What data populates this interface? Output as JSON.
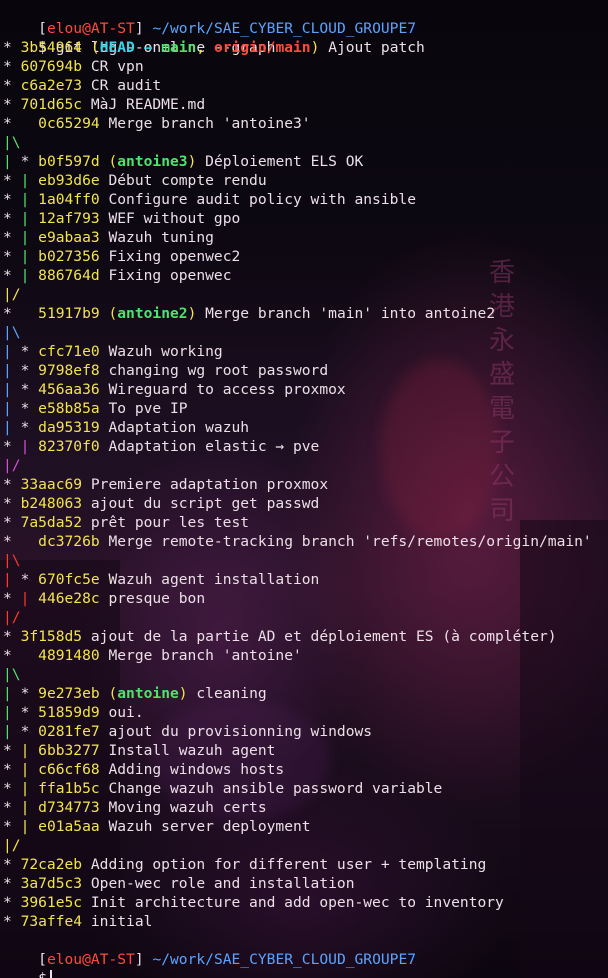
{
  "prompt": {
    "open_bracket": "[",
    "user": "elou",
    "at": "@",
    "host": "AT-ST",
    "close_bracket": "]",
    "path": "~/work/SAE_CYBER_CLOUD_GROUPE7",
    "dollar": "$"
  },
  "command": "git log --oneline --graph",
  "colors": {
    "hash": "#f2e44f",
    "head_ref": "#36d6e7",
    "local_branch": "#4fe36b",
    "remote_branch": "#ff4a3a",
    "path": "#5aa3ff",
    "prompt_user": "#ff4a3a",
    "graph_green": "#4fe36b",
    "graph_blue": "#5aa3ff",
    "graph_magenta": "#d64fd6",
    "graph_red": "#ff3a2a",
    "graph_yellow": "#f2e44f"
  },
  "log": [
    {
      "graph": [
        [
          "* ",
          ""
        ]
      ],
      "hash": "3b54964",
      "refs": "head_main",
      "msg": "Ajout patch"
    },
    {
      "graph": [
        [
          "* ",
          ""
        ]
      ],
      "hash": "607694b",
      "msg": "CR vpn"
    },
    {
      "graph": [
        [
          "* ",
          ""
        ]
      ],
      "hash": "c6a2e73",
      "msg": "CR audit"
    },
    {
      "graph": [
        [
          "* ",
          ""
        ]
      ],
      "hash": "701d65c",
      "msg": "MàJ README.md"
    },
    {
      "graph": [
        [
          "*   ",
          ""
        ]
      ],
      "hash": "0c65294",
      "msg": "Merge branch 'antoine3'"
    },
    {
      "graph": [
        [
          "|\\",
          "green"
        ]
      ]
    },
    {
      "graph": [
        [
          "| ",
          "green"
        ],
        [
          "* ",
          ""
        ]
      ],
      "hash": "b0f597d",
      "refs": "antoine3",
      "msg": "Déploiement ELS OK"
    },
    {
      "graph": [
        [
          "* ",
          ""
        ],
        [
          "| ",
          "green"
        ]
      ],
      "hash": "eb93d6e",
      "msg": "Début compte rendu"
    },
    {
      "graph": [
        [
          "* ",
          ""
        ],
        [
          "| ",
          "green"
        ]
      ],
      "hash": "1a04ff0",
      "msg": "Configure audit policy with ansible"
    },
    {
      "graph": [
        [
          "* ",
          ""
        ],
        [
          "| ",
          "green"
        ]
      ],
      "hash": "12af793",
      "msg": "WEF without gpo"
    },
    {
      "graph": [
        [
          "* ",
          ""
        ],
        [
          "| ",
          "green"
        ]
      ],
      "hash": "e9abaa3",
      "msg": "Wazuh tuning"
    },
    {
      "graph": [
        [
          "* ",
          ""
        ],
        [
          "| ",
          "green"
        ]
      ],
      "hash": "b027356",
      "msg": "Fixing openwec2"
    },
    {
      "graph": [
        [
          "* ",
          ""
        ],
        [
          "| ",
          "green"
        ]
      ],
      "hash": "886764d",
      "msg": "Fixing openwec"
    },
    {
      "graph": [
        [
          "|/",
          "yellow"
        ]
      ]
    },
    {
      "graph": [
        [
          "*   ",
          ""
        ]
      ],
      "hash": "51917b9",
      "refs": "antoine2",
      "msg": "Merge branch 'main' into antoine2"
    },
    {
      "graph": [
        [
          "|\\",
          "blue"
        ]
      ]
    },
    {
      "graph": [
        [
          "| ",
          "blue"
        ],
        [
          "* ",
          ""
        ]
      ],
      "hash": "cfc71e0",
      "msg": "Wazuh working"
    },
    {
      "graph": [
        [
          "| ",
          "blue"
        ],
        [
          "* ",
          ""
        ]
      ],
      "hash": "9798ef8",
      "msg": "changing wg root password"
    },
    {
      "graph": [
        [
          "| ",
          "blue"
        ],
        [
          "* ",
          ""
        ]
      ],
      "hash": "456aa36",
      "msg": "Wireguard to access proxmox"
    },
    {
      "graph": [
        [
          "| ",
          "blue"
        ],
        [
          "* ",
          ""
        ]
      ],
      "hash": "e58b85a",
      "msg": "To pve IP"
    },
    {
      "graph": [
        [
          "| ",
          "blue"
        ],
        [
          "* ",
          ""
        ]
      ],
      "hash": "da95319",
      "msg": "Adaptation wazuh"
    },
    {
      "graph": [
        [
          "* ",
          ""
        ],
        [
          "| ",
          "magenta"
        ]
      ],
      "hash": "82370f0",
      "msg": "Adaptation elastic → pve"
    },
    {
      "graph": [
        [
          "|/",
          "magenta"
        ]
      ]
    },
    {
      "graph": [
        [
          "* ",
          ""
        ]
      ],
      "hash": "33aac69",
      "msg": "Premiere adaptation proxmox"
    },
    {
      "graph": [
        [
          "* ",
          ""
        ]
      ],
      "hash": "b248063",
      "msg": "ajout du script get passwd"
    },
    {
      "graph": [
        [
          "* ",
          ""
        ]
      ],
      "hash": "7a5da52",
      "msg": "prêt pour les test"
    },
    {
      "graph": [
        [
          "*   ",
          ""
        ]
      ],
      "hash": "dc3726b",
      "msg": "Merge remote-tracking branch 'refs/remotes/origin/main'"
    },
    {
      "graph": [
        [
          "|\\",
          "red"
        ]
      ]
    },
    {
      "graph": [
        [
          "| ",
          "red"
        ],
        [
          "* ",
          ""
        ]
      ],
      "hash": "670fc5e",
      "msg": "Wazuh agent installation"
    },
    {
      "graph": [
        [
          "* ",
          ""
        ],
        [
          "| ",
          "red"
        ]
      ],
      "hash": "446e28c",
      "msg": "presque bon"
    },
    {
      "graph": [
        [
          "|/",
          "red"
        ]
      ]
    },
    {
      "graph": [
        [
          "* ",
          ""
        ]
      ],
      "hash": "3f158d5",
      "msg": "ajout de la partie AD et déploiement ES (à compléter)"
    },
    {
      "graph": [
        [
          "*   ",
          ""
        ]
      ],
      "hash": "4891480",
      "msg": "Merge branch 'antoine'"
    },
    {
      "graph": [
        [
          "|\\",
          "green"
        ]
      ]
    },
    {
      "graph": [
        [
          "| ",
          "green"
        ],
        [
          "* ",
          ""
        ]
      ],
      "hash": "9e273eb",
      "refs": "antoine",
      "msg": "cleaning"
    },
    {
      "graph": [
        [
          "| ",
          "green"
        ],
        [
          "* ",
          ""
        ]
      ],
      "hash": "51859d9",
      "msg": "oui."
    },
    {
      "graph": [
        [
          "| ",
          "green"
        ],
        [
          "* ",
          ""
        ]
      ],
      "hash": "0281fe7",
      "msg": "ajout du provisionning windows"
    },
    {
      "graph": [
        [
          "* ",
          ""
        ],
        [
          "| ",
          "yellow"
        ]
      ],
      "hash": "6bb3277",
      "msg": "Install wazuh agent"
    },
    {
      "graph": [
        [
          "* ",
          ""
        ],
        [
          "| ",
          "yellow"
        ]
      ],
      "hash": "c66cf68",
      "msg": "Adding windows hosts"
    },
    {
      "graph": [
        [
          "* ",
          ""
        ],
        [
          "| ",
          "yellow"
        ]
      ],
      "hash": "ffa1b5c",
      "msg": "Change wazuh ansible password variable"
    },
    {
      "graph": [
        [
          "* ",
          ""
        ],
        [
          "| ",
          "yellow"
        ]
      ],
      "hash": "d734773",
      "msg": "Moving wazuh certs"
    },
    {
      "graph": [
        [
          "* ",
          ""
        ],
        [
          "| ",
          "yellow"
        ]
      ],
      "hash": "e01a5aa",
      "msg": "Wazuh server deployment"
    },
    {
      "graph": [
        [
          "|/",
          "yellow"
        ]
      ]
    },
    {
      "graph": [
        [
          "* ",
          ""
        ]
      ],
      "hash": "72ca2eb",
      "msg": "Adding option for different user + templating"
    },
    {
      "graph": [
        [
          "* ",
          ""
        ]
      ],
      "hash": "3a7d5c3",
      "msg": "Open-wec role and installation"
    },
    {
      "graph": [
        [
          "* ",
          ""
        ]
      ],
      "hash": "3961e5c",
      "msg": "Init architecture and add open-wec to inventory"
    },
    {
      "graph": [
        [
          "* ",
          ""
        ]
      ],
      "hash": "73affe4",
      "msg": "initial"
    }
  ],
  "ref_labels": {
    "open": "(",
    "close": ")",
    "head": "HEAD",
    "arrow": " → ",
    "main": "main",
    "comma": ", ",
    "origin_main": "origin/main",
    "antoine3": "antoine3",
    "antoine2": "antoine2",
    "antoine": "antoine"
  },
  "background": {
    "sign_chars": [
      "香",
      "港",
      "永",
      "盛",
      "電",
      "子",
      "公",
      "司"
    ]
  }
}
